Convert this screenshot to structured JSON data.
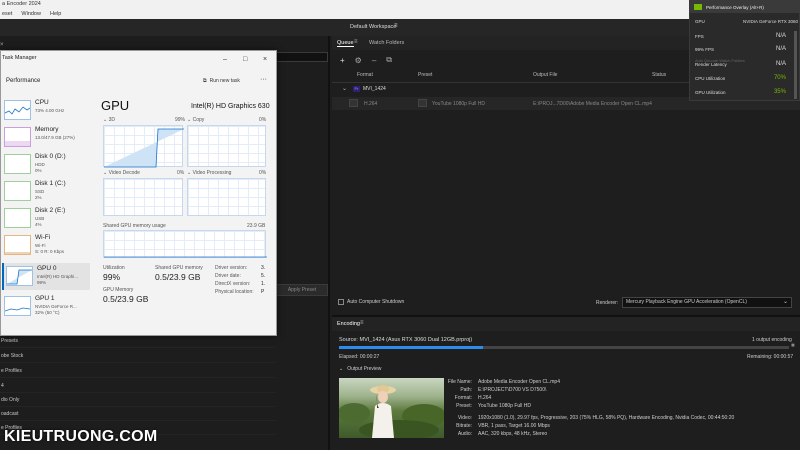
{
  "app": {
    "title": "a Encoder 2024",
    "menu": [
      "eset",
      "Window",
      "Help"
    ],
    "workspace": "Default Workspace"
  },
  "task_manager": {
    "title": "Task Manager",
    "section": "Performance",
    "run_new_task": "Run new task",
    "sidebar": [
      {
        "name": "CPU",
        "sub1": "73% 4.00 GHz",
        "sub2": "",
        "sub3": ""
      },
      {
        "name": "Memory",
        "sub1": "13.0/47.9 GB (27%)",
        "sub2": "",
        "sub3": ""
      },
      {
        "name": "Disk 0 (D:)",
        "sub1": "HDD",
        "sub2": "0%",
        "sub3": ""
      },
      {
        "name": "Disk 1 (C:)",
        "sub1": "SSD",
        "sub2": "2%",
        "sub3": ""
      },
      {
        "name": "Disk 2 (E:)",
        "sub1": "USB",
        "sub2": "4%",
        "sub3": ""
      },
      {
        "name": "Wi-Fi",
        "sub1": "Wi-Fi",
        "sub2": "S: 0 R: 0 Kbps",
        "sub3": ""
      },
      {
        "name": "GPU 0",
        "sub1": "Intel(R) HD Graphi...",
        "sub2": "99%",
        "sub3": ""
      },
      {
        "name": "GPU 1",
        "sub1": "NVIDIA GeForce R...",
        "sub2": "32% (50 °C)",
        "sub3": ""
      }
    ],
    "gpu": {
      "heading": "GPU",
      "model": "Intel(R) HD Graphics 630",
      "graphs": [
        {
          "label": "3D",
          "pct": "99%"
        },
        {
          "label": "Copy",
          "pct": "0%"
        },
        {
          "label": "Video Decode",
          "pct": "0%"
        },
        {
          "label": "Video Processing",
          "pct": "0%"
        }
      ],
      "shared_label": "Shared GPU memory usage",
      "shared_max": "23.9 GB",
      "utilization_label": "Utilization",
      "utilization_value": "99%",
      "shared_mem_label": "Shared GPU memory",
      "shared_mem_value": "0.5/23.9 GB",
      "gpu_mem_label": "GPU Memory",
      "gpu_mem_value": "0.5/23.9 GB",
      "details": [
        {
          "k": "Driver version:",
          "v": "3."
        },
        {
          "k": "Driver date:",
          "v": "5."
        },
        {
          "k": "DirectX version:",
          "v": "1."
        },
        {
          "k": "Physical location:",
          "v": "P"
        }
      ]
    }
  },
  "left_list": {
    "apply_preset": "Apply Preset",
    "rows": [
      "Presets",
      "obe Stock",
      "e Profiles",
      "4",
      "dio Only",
      "oadcast",
      "e Profiles"
    ]
  },
  "queue": {
    "tabs": [
      "Queue",
      "Watch Folders"
    ],
    "columns": [
      "Format",
      "Preset",
      "Output File",
      "Status"
    ],
    "group": "MVI_1424",
    "item": {
      "format": "H.264",
      "preset": "YouTube 1080p Full HD",
      "output": "E:\\PROJ...7D00\\Adobe Media Encoder Open CL.mp4"
    },
    "auto_shutdown": "Auto Computer Shutdown",
    "renderer_label": "Renderer:",
    "renderer_value": "Mercury Playback Engine GPU Acceleration (OpenCL)"
  },
  "encoding": {
    "tab": "Encoding",
    "source": "Source: MVI_1424 (Asus RTX 3060 Dual 12GB.prproj)",
    "output_count": "1 output encoding",
    "elapsed": "Elapsed: 00:00:27",
    "remaining": "Remaining: 00:00:57",
    "progress": 0.32,
    "preview_label": "Output Preview",
    "details": [
      {
        "k": "File Name:",
        "v": "Adobe Media Encoder Open CL.mp4"
      },
      {
        "k": "Path:",
        "v": "E:\\PROJECT\\D700 VS D7500\\"
      },
      {
        "k": "Format:",
        "v": "H.264"
      },
      {
        "k": "Preset:",
        "v": "YouTube 1080p Full HD"
      },
      {
        "k": "Video:",
        "v": "1920x1080 (1.0), 29.97 fps, Progressive, 203 (75% HLG, 58% PQ), Hardware Encoding, Nvidia Codec, 00:44:50:20"
      },
      {
        "k": "Bitrate:",
        "v": "VBR, 1 pass, Target 16.00 Mbps"
      },
      {
        "k": "Audio:",
        "v": "AAC, 320 kbps, 48 kHz, Stereo"
      }
    ]
  },
  "overlay": {
    "title": "Performance Overlay (Alt+R)",
    "gpu_label": "GPU",
    "gpu_value": "NVIDIA GeForce RTX 3060",
    "rows": [
      {
        "label": "FPS",
        "value": "N/A",
        "color": "#dddddd"
      },
      {
        "label": "99% FPS",
        "value": "N/A",
        "color": "#dddddd"
      },
      {
        "label": "Render Latency",
        "value": "N/A",
        "color": "#dddddd"
      },
      {
        "label": "CPU Utilization",
        "value": "70",
        "unit": "%",
        "color": "#76b900"
      },
      {
        "label": "GPU Utilization",
        "value": "35",
        "unit": "%",
        "color": "#76b900"
      }
    ],
    "decode_hint": "Auto Decode Watch Folders"
  },
  "watermark": "KIEUTRUONG.COM",
  "colors": {
    "accent": "#76b900",
    "tm_blue": "#0067c0",
    "panel": "#1e1e1e"
  }
}
